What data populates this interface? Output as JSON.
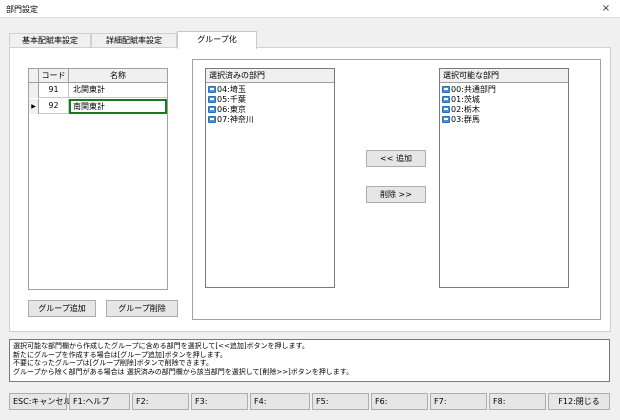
{
  "window": {
    "title": "部門設定",
    "close_glyph": "×"
  },
  "tabs": [
    {
      "label": "基本配賦率設定"
    },
    {
      "label": "詳細配賦率設定"
    },
    {
      "label": "グループ化"
    }
  ],
  "group_grid": {
    "headers": {
      "code": "コード",
      "name": "名称"
    },
    "rows": [
      {
        "code": "91",
        "name": "北関東計",
        "marker": ""
      },
      {
        "code": "92",
        "name": "南関東計",
        "marker": "▶"
      }
    ]
  },
  "buttons": {
    "add_group": "グループ追加",
    "delete_group": "グループ削除",
    "add": "<< 追加",
    "remove": "削除 >>"
  },
  "selected_list": {
    "header": "選択済みの部門",
    "items": [
      "04:埼玉",
      "05:千葉",
      "06:東京",
      "07:神奈川"
    ]
  },
  "available_list": {
    "header": "選択可能な部門",
    "items": [
      "00:共通部門",
      "01:茨城",
      "02:栃木",
      "03:群馬"
    ]
  },
  "message_lines": [
    "選択可能な部門欄から作成したグループに含める部門を選択して[<<追加]ボタンを押します。",
    "新たにグループを作成する場合は[グループ追加]ボタンを押します。",
    "不要になったグループは[グループ削除]ボタンで削除できます。",
    "グループから除く部門がある場合は 選択済みの部門欄から該当部門を選択して[削除>>]ボタンを押します。"
  ],
  "function_keys": [
    "ESC:キャンセル",
    "F1:ヘルプ",
    "F2:",
    "F3:",
    "F4:",
    "F5:",
    "F6:",
    "F7:",
    "F8:",
    "F12:閉じる"
  ],
  "icons": {
    "dept": "department-icon",
    "row_pointer": "row-pointer-icon",
    "close": "close-icon"
  }
}
